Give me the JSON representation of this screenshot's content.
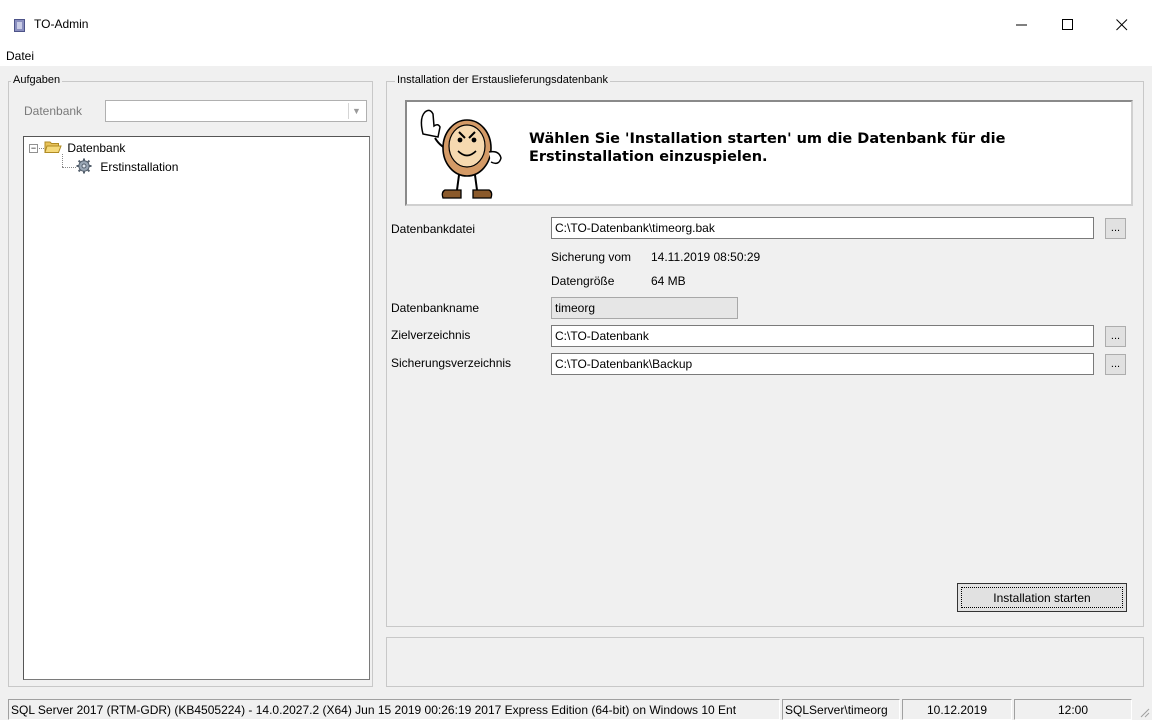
{
  "window": {
    "title": "TO-Admin",
    "controls": {
      "minimize": "minimize-icon",
      "maximize": "maximize-icon",
      "close": "close-icon"
    }
  },
  "menu": {
    "items": [
      "Datei"
    ]
  },
  "tasks": {
    "legend": "Aufgaben",
    "db_label": "Datenbank",
    "db_select_value": "",
    "tree": [
      {
        "label": "Datenbank",
        "icon": "folder-open-icon",
        "expander": "−"
      },
      {
        "label": "Erstinstallation",
        "icon": "gear-icon"
      }
    ]
  },
  "install": {
    "legend": "Installation der Erstauslieferungsdatenbank",
    "banner_text": "Wählen Sie 'Installation starten' um die Datenbank für die Erstinstallation einzuspielen.",
    "banner_icon": "clock-mascot-icon",
    "db_file_label": "Datenbankdatei",
    "db_file_value": "C:\\TO-Datenbank\\timeorg.bak",
    "backup_from_label": "Sicherung vom",
    "backup_from_value": "14.11.2019 08:50:29",
    "data_size_label": "Datengröße",
    "data_size_value": "64 MB",
    "db_name_label": "Datenbankname",
    "db_name_value": "timeorg",
    "target_dir_label": "Zielverzeichnis",
    "target_dir_value": "C:\\TO-Datenbank",
    "backup_dir_label": "Sicherungsverzeichnis",
    "backup_dir_value": "C:\\TO-Datenbank\\Backup",
    "browse_label": "...",
    "start_button": "Installation starten"
  },
  "status": {
    "server_info": "SQL Server 2017 (RTM-GDR) (KB4505224) - 14.0.2027.2 (X64) Jun 15 2019 00:26:19 2017 Express Edition (64-bit) on Windows 10 Ent",
    "connection": "SQLServer\\timeorg",
    "date": "10.12.2019",
    "time": "12:00"
  }
}
